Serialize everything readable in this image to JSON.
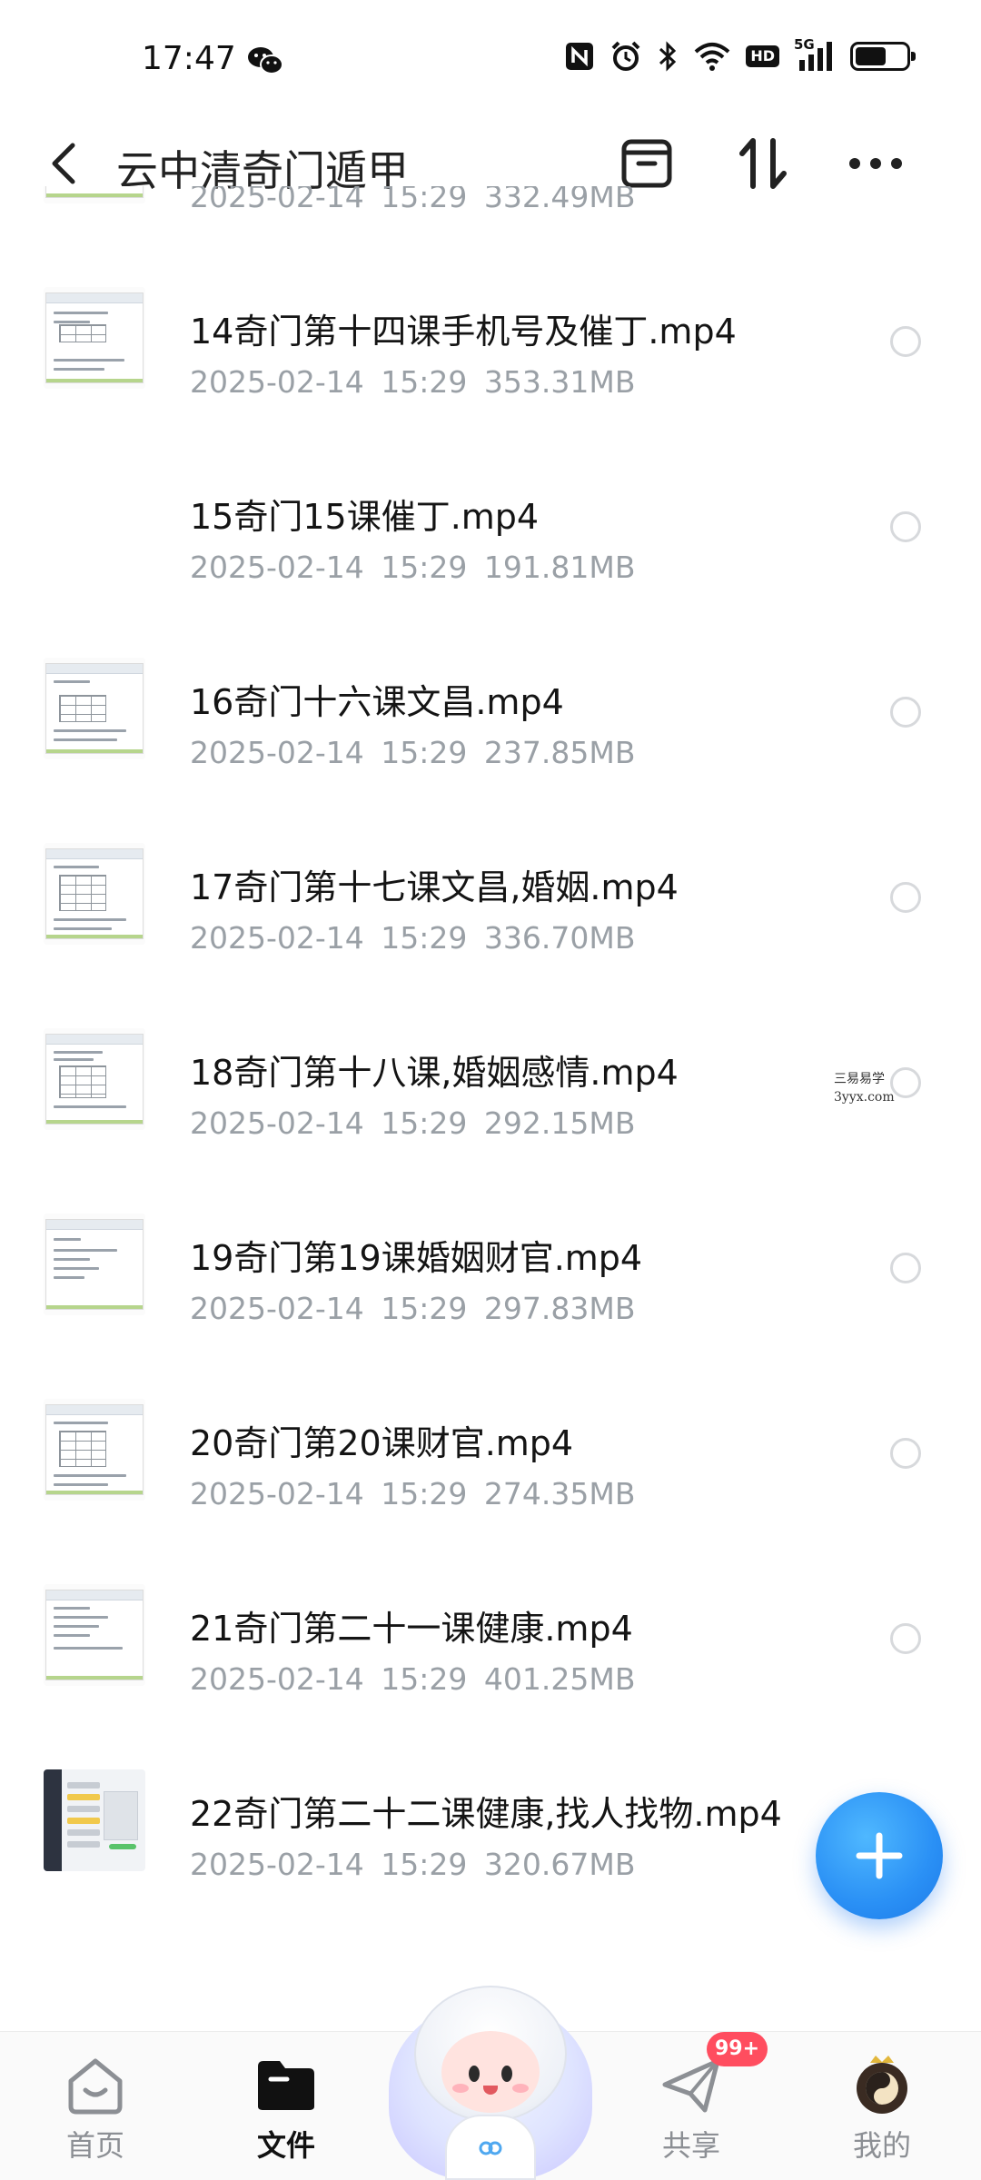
{
  "status_bar": {
    "time": "17:47",
    "icons": [
      "wechat-icon",
      "nfc-icon",
      "alarm-icon",
      "bluetooth-icon",
      "wifi-icon",
      "hd-badge",
      "5g-signal-icon",
      "battery-icon"
    ],
    "hd": "HD",
    "network": "5G"
  },
  "header": {
    "title": "云中清奇门遁甲",
    "icons": [
      "back-arrow-icon",
      "archive-icon",
      "sort-icon",
      "more-icon"
    ]
  },
  "files": [
    {
      "name": "",
      "date": "2025-02-14",
      "time": "15:29",
      "size": "332.49MB"
    },
    {
      "name": "14奇门第十四课手机号及催丁.mp4",
      "date": "2025-02-14",
      "time": "15:29",
      "size": "353.31MB"
    },
    {
      "name": "15奇门15课催丁.mp4",
      "date": "2025-02-14",
      "time": "15:29",
      "size": "191.81MB"
    },
    {
      "name": "16奇门十六课文昌.mp4",
      "date": "2025-02-14",
      "time": "15:29",
      "size": "237.85MB"
    },
    {
      "name": "17奇门第十七课文昌,婚姻.mp4",
      "date": "2025-02-14",
      "time": "15:29",
      "size": "336.70MB"
    },
    {
      "name": "18奇门第十八课,婚姻感情.mp4",
      "date": "2025-02-14",
      "time": "15:29",
      "size": "292.15MB"
    },
    {
      "name": "19奇门第19课婚姻财官.mp4",
      "date": "2025-02-14",
      "time": "15:29",
      "size": "297.83MB"
    },
    {
      "name": "20奇门第20课财官.mp4",
      "date": "2025-02-14",
      "time": "15:29",
      "size": "274.35MB"
    },
    {
      "name": "21奇门第二十一课健康.mp4",
      "date": "2025-02-14",
      "time": "15:29",
      "size": "401.25MB"
    },
    {
      "name": "22奇门第二十二课健康,找人找物.mp4",
      "date": "2025-02-14",
      "time": "15:29",
      "size": "320.67MB"
    }
  ],
  "watermark": {
    "line1": "三易易学",
    "line2": "3yyx.com"
  },
  "fab": {
    "icon": "plus-icon"
  },
  "bottom_nav": {
    "items": [
      {
        "label": "首页",
        "icon": "home-icon"
      },
      {
        "label": "文件",
        "icon": "folder-icon"
      },
      {
        "label": "共享",
        "icon": "send-icon"
      },
      {
        "label": "我的",
        "icon": "avatar-icon"
      }
    ],
    "share_badge": "99+",
    "center_icon": "mascot-icon"
  },
  "colors": {
    "accent": "#2a90f5",
    "badge": "#ff4d5f",
    "meta_text": "#9aa0a6"
  }
}
